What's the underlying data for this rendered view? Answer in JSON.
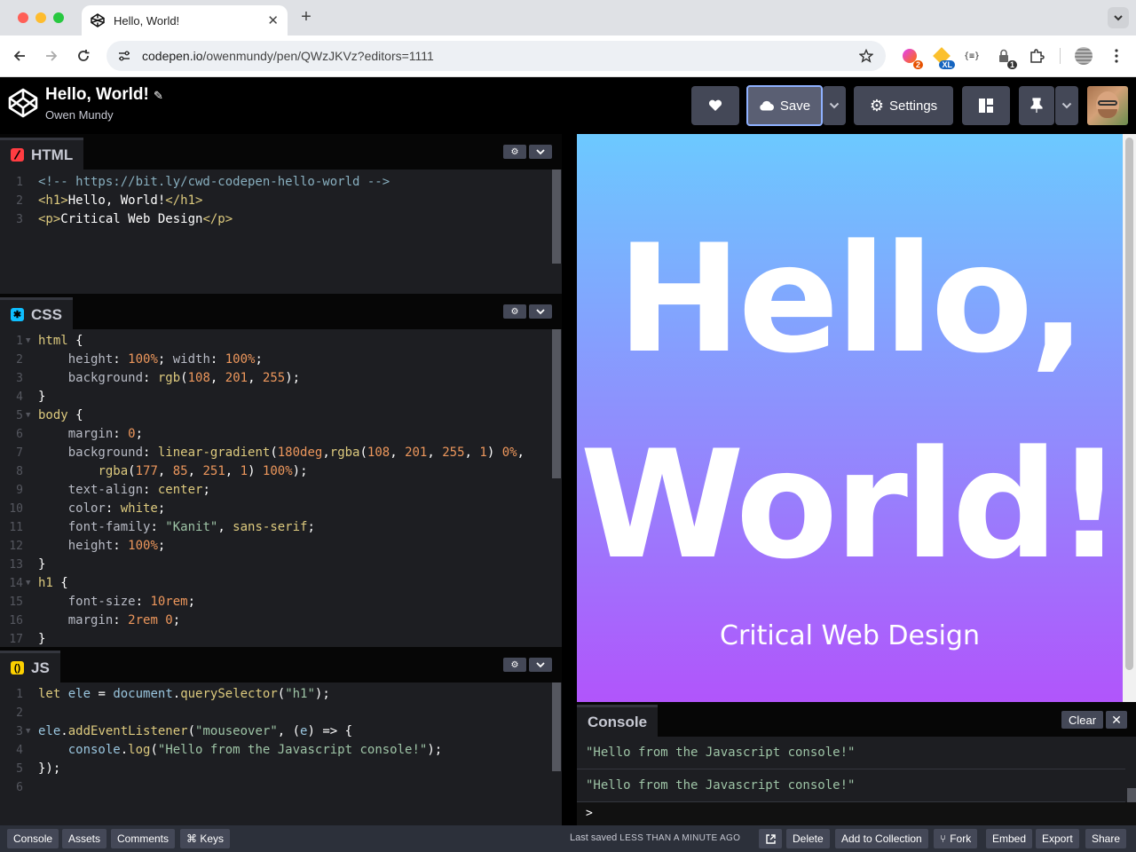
{
  "browser": {
    "tab_title": "Hello, World!",
    "tab_close": "✕",
    "new_tab": "+",
    "url_host": "codepen.io",
    "url_path": "/owenmundy/pen/QWzJKVz?editors=1111",
    "extension_badge_1": "2",
    "extension_badge_2": "XL",
    "extension_badge_3": "{≡}",
    "extension_badge_4": "1"
  },
  "header": {
    "pen_title": "Hello, World!",
    "author": "Owen Mundy",
    "save_label": "Save",
    "settings_label": "Settings"
  },
  "editors": {
    "html": {
      "label": "HTML",
      "icon_color": "#ff3c41",
      "lines": [
        {
          "n": "1",
          "segments": [
            [
              "c-com",
              "<!-- https://bit.ly/cwd-codepen-hello-world -->"
            ]
          ]
        },
        {
          "n": "2",
          "segments": [
            [
              "c-tag",
              "<h1>"
            ],
            [
              "c-txt",
              "Hello, World!"
            ],
            [
              "c-tag",
              "</h1>"
            ]
          ]
        },
        {
          "n": "3",
          "segments": [
            [
              "c-tag",
              "<p>"
            ],
            [
              "c-txt",
              "Critical Web Design"
            ],
            [
              "c-tag",
              "</p>"
            ]
          ]
        }
      ]
    },
    "css": {
      "label": "CSS",
      "icon_color": "#0ebeff",
      "lines": [
        {
          "n": "1",
          "fold": true,
          "segments": [
            [
              "c-tag",
              "html"
            ],
            [
              "c-txt",
              " {"
            ]
          ]
        },
        {
          "n": "2",
          "segments": [
            [
              "c-prop",
              "    height"
            ],
            [
              "c-txt",
              ": "
            ],
            [
              "c-num",
              "100%"
            ],
            [
              "c-txt",
              "; "
            ],
            [
              "c-prop",
              "width"
            ],
            [
              "c-txt",
              ": "
            ],
            [
              "c-num",
              "100%"
            ],
            [
              "c-txt",
              ";"
            ]
          ]
        },
        {
          "n": "3",
          "segments": [
            [
              "c-prop",
              "    background"
            ],
            [
              "c-txt",
              ": "
            ],
            [
              "c-tag",
              "rgb"
            ],
            [
              "c-txt",
              "("
            ],
            [
              "c-num",
              "108"
            ],
            [
              "c-txt",
              ", "
            ],
            [
              "c-num",
              "201"
            ],
            [
              "c-txt",
              ", "
            ],
            [
              "c-num",
              "255"
            ],
            [
              "c-txt",
              ");"
            ]
          ]
        },
        {
          "n": "4",
          "segments": [
            [
              "c-txt",
              "}"
            ]
          ]
        },
        {
          "n": "5",
          "fold": true,
          "segments": [
            [
              "c-tag",
              "body"
            ],
            [
              "c-txt",
              " {"
            ]
          ]
        },
        {
          "n": "6",
          "segments": [
            [
              "c-prop",
              "    margin"
            ],
            [
              "c-txt",
              ": "
            ],
            [
              "c-num",
              "0"
            ],
            [
              "c-txt",
              ";"
            ]
          ]
        },
        {
          "n": "7",
          "segments": [
            [
              "c-prop",
              "    background"
            ],
            [
              "c-txt",
              ": "
            ],
            [
              "c-tag",
              "linear-gradient"
            ],
            [
              "c-txt",
              "("
            ],
            [
              "c-num",
              "180deg"
            ],
            [
              "c-txt",
              ","
            ],
            [
              "c-tag",
              "rgba"
            ],
            [
              "c-txt",
              "("
            ],
            [
              "c-num",
              "108"
            ],
            [
              "c-txt",
              ", "
            ],
            [
              "c-num",
              "201"
            ],
            [
              "c-txt",
              ", "
            ],
            [
              "c-num",
              "255"
            ],
            [
              "c-txt",
              ", "
            ],
            [
              "c-num",
              "1"
            ],
            [
              "c-txt",
              ") "
            ],
            [
              "c-num",
              "0%"
            ],
            [
              "c-txt",
              ","
            ]
          ]
        },
        {
          "n": "8",
          "segments": [
            [
              "c-txt",
              "        "
            ],
            [
              "c-tag",
              "rgba"
            ],
            [
              "c-txt",
              "("
            ],
            [
              "c-num",
              "177"
            ],
            [
              "c-txt",
              ", "
            ],
            [
              "c-num",
              "85"
            ],
            [
              "c-txt",
              ", "
            ],
            [
              "c-num",
              "251"
            ],
            [
              "c-txt",
              ", "
            ],
            [
              "c-num",
              "1"
            ],
            [
              "c-txt",
              ") "
            ],
            [
              "c-num",
              "100%"
            ],
            [
              "c-txt",
              ");"
            ]
          ]
        },
        {
          "n": "9",
          "segments": [
            [
              "c-prop",
              "    text-align"
            ],
            [
              "c-txt",
              ": "
            ],
            [
              "c-tag",
              "center"
            ],
            [
              "c-txt",
              ";"
            ]
          ]
        },
        {
          "n": "10",
          "segments": [
            [
              "c-prop",
              "    color"
            ],
            [
              "c-txt",
              ": "
            ],
            [
              "c-tag",
              "white"
            ],
            [
              "c-txt",
              ";"
            ]
          ]
        },
        {
          "n": "11",
          "segments": [
            [
              "c-prop",
              "    font-family"
            ],
            [
              "c-txt",
              ": "
            ],
            [
              "c-str",
              "\"Kanit\""
            ],
            [
              "c-txt",
              ", "
            ],
            [
              "c-tag",
              "sans-serif"
            ],
            [
              "c-txt",
              ";"
            ]
          ]
        },
        {
          "n": "12",
          "segments": [
            [
              "c-prop",
              "    height"
            ],
            [
              "c-txt",
              ": "
            ],
            [
              "c-num",
              "100%"
            ],
            [
              "c-txt",
              ";"
            ]
          ]
        },
        {
          "n": "13",
          "segments": [
            [
              "c-txt",
              "}"
            ]
          ]
        },
        {
          "n": "14",
          "fold": true,
          "segments": [
            [
              "c-tag",
              "h1"
            ],
            [
              "c-txt",
              " {"
            ]
          ]
        },
        {
          "n": "15",
          "segments": [
            [
              "c-prop",
              "    font-size"
            ],
            [
              "c-txt",
              ": "
            ],
            [
              "c-num",
              "10rem"
            ],
            [
              "c-txt",
              ";"
            ]
          ]
        },
        {
          "n": "16",
          "segments": [
            [
              "c-prop",
              "    margin"
            ],
            [
              "c-txt",
              ": "
            ],
            [
              "c-num",
              "2rem 0"
            ],
            [
              "c-txt",
              ";"
            ]
          ]
        },
        {
          "n": "17",
          "segments": [
            [
              "c-txt",
              "}"
            ]
          ]
        }
      ]
    },
    "js": {
      "label": "JS",
      "icon_color": "#fcd000",
      "lines": [
        {
          "n": "1",
          "segments": [
            [
              "c-kw",
              "let"
            ],
            [
              "c-var",
              " ele"
            ],
            [
              "c-txt",
              " = "
            ],
            [
              "c-var",
              "document"
            ],
            [
              "c-txt",
              "."
            ],
            [
              "c-mth",
              "querySelector"
            ],
            [
              "c-txt",
              "("
            ],
            [
              "c-str",
              "\"h1\""
            ],
            [
              "c-txt",
              ");"
            ]
          ]
        },
        {
          "n": "2",
          "segments": []
        },
        {
          "n": "3",
          "fold": true,
          "segments": [
            [
              "c-var",
              "ele"
            ],
            [
              "c-txt",
              "."
            ],
            [
              "c-mth",
              "addEventListener"
            ],
            [
              "c-txt",
              "("
            ],
            [
              "c-str",
              "\"mouseover\""
            ],
            [
              "c-txt",
              ", ("
            ],
            [
              "c-var",
              "e"
            ],
            [
              "c-txt",
              ") => {"
            ]
          ]
        },
        {
          "n": "4",
          "segments": [
            [
              "c-var",
              "    console"
            ],
            [
              "c-txt",
              "."
            ],
            [
              "c-mth",
              "log"
            ],
            [
              "c-txt",
              "("
            ],
            [
              "c-str",
              "\"Hello from the Javascript console!\""
            ],
            [
              "c-txt",
              ");"
            ]
          ]
        },
        {
          "n": "5",
          "segments": [
            [
              "c-txt",
              "});"
            ]
          ]
        },
        {
          "n": "6",
          "segments": []
        }
      ]
    }
  },
  "preview": {
    "h1_line1": "Hello,",
    "h1_line2": "World!",
    "p": "Critical Web Design"
  },
  "console": {
    "label": "Console",
    "clear_label": "Clear",
    "messages": [
      "\"Hello from the Javascript console!\"",
      "\"Hello from the Javascript console!\""
    ],
    "prompt": ">"
  },
  "footer": {
    "left_buttons": [
      "Console",
      "Assets",
      "Comments",
      "⌘ Keys"
    ],
    "last_saved_prefix": "Last saved",
    "last_saved_time": "LESS THAN A MINUTE AGO",
    "right_buttons": [
      "Delete",
      "Add to Collection",
      "Fork",
      "Embed",
      "Export",
      "Share"
    ]
  }
}
